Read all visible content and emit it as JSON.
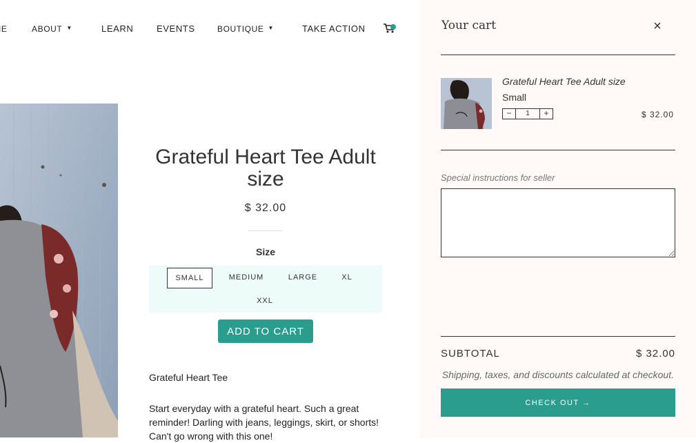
{
  "nav": {
    "home_partial": "IE",
    "about": "ABOUT",
    "learn": "LEARN",
    "events": "EVENTS",
    "boutique": "BOUTIQUE",
    "take_action": "TAKE ACTION",
    "dropdown_glyph": "▼",
    "cart_icon": "cart-icon"
  },
  "product": {
    "title": "Grateful Heart Tee Adult size",
    "price": "$ 32.00",
    "size_label": "Size",
    "sizes": [
      "SMALL",
      "MEDIUM",
      "LARGE",
      "XL",
      "XXL"
    ],
    "selected_size": "SMALL",
    "add_to_cart": "ADD TO CART",
    "description_title": "Grateful Heart Tee",
    "description_body": "Start everyday with a grateful heart. Such a great reminder!  Darling with jeans, leggings, skirt, or shorts! Can't go wrong with this one!"
  },
  "cart": {
    "title": "Your cart",
    "close_glyph": "×",
    "item": {
      "name": "Grateful Heart Tee Adult size",
      "variant": "Small",
      "quantity": "1",
      "minus": "−",
      "plus": "+",
      "price": "$ 32.00"
    },
    "notes_label": "Special instructions for seller",
    "subtotal_label": "SUBTOTAL",
    "subtotal_value": "$ 32.00",
    "shipping_note": "Shipping, taxes, and discounts calculated at checkout.",
    "checkout": "CHECK OUT →"
  },
  "colors": {
    "accent": "#2a9d8f",
    "size_panel_bg": "#edfbf9",
    "drawer_bg": "#fffaf7",
    "text": "#333333"
  }
}
